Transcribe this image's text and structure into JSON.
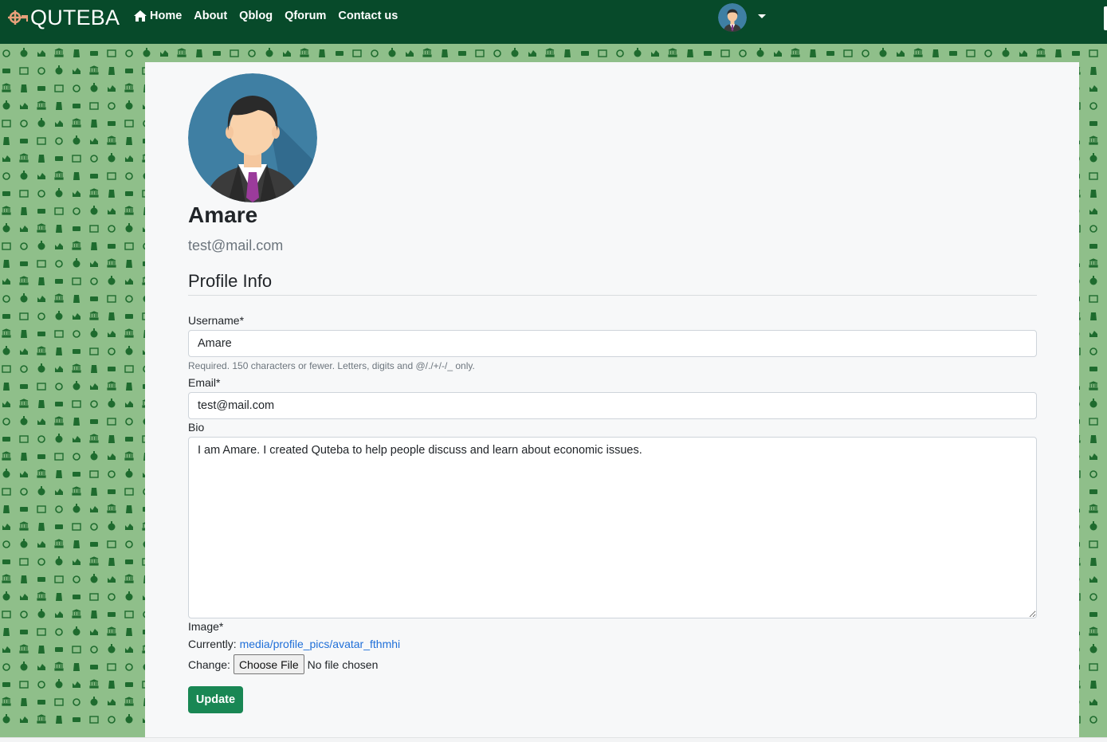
{
  "navbar": {
    "brand": "QUTEBA",
    "links": [
      {
        "label": "Home",
        "icon": "home-icon"
      },
      {
        "label": "About"
      },
      {
        "label": "Qblog"
      },
      {
        "label": "Qforum"
      },
      {
        "label": "Contact us"
      }
    ],
    "user_menu_icon": "chevron-down-icon",
    "colors": {
      "background": "#074a2a",
      "brand_mark": "#e8a07a"
    }
  },
  "background": {
    "pattern_color": "#1e6b2e",
    "base_color": "#8fbf8a"
  },
  "profile": {
    "name": "Amare",
    "email": "test@mail.com",
    "section_title": "Profile Info"
  },
  "form": {
    "username_label": "Username*",
    "username_value": "Amare",
    "username_help": "Required. 150 characters or fewer. Letters, digits and @/./+/-/_ only.",
    "email_label": "Email*",
    "email_value": "test@mail.com",
    "bio_label": "Bio",
    "bio_value": "I am Amare. I created Quteba to help people discuss and learn about economic issues.",
    "image_label": "Image*",
    "currently_label": "Currently:",
    "currently_link": "media/profile_pics/avatar_fthmhi",
    "change_label": "Change:",
    "choose_file_label": "Choose File",
    "no_file_text": "No file chosen",
    "update_label": "Update",
    "colors": {
      "primary_button": "#198754",
      "link": "#1f6fd8"
    }
  }
}
